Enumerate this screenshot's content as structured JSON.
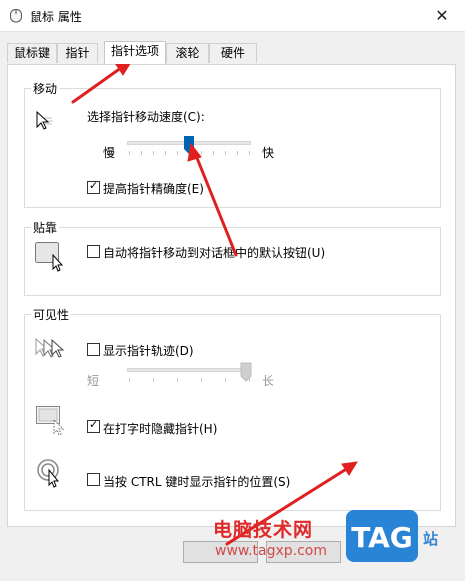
{
  "window": {
    "title": "鼠标 属性",
    "close_symbol": "✕"
  },
  "tabs": [
    {
      "label": "鼠标键",
      "selected": false
    },
    {
      "label": "指针",
      "selected": false
    },
    {
      "label": "指针选项",
      "selected": true
    },
    {
      "label": "滚轮",
      "selected": false
    },
    {
      "label": "硬件",
      "selected": false
    }
  ],
  "motion": {
    "title": "移动",
    "speed_label": "选择指针移动速度(C):",
    "slow_label": "慢",
    "fast_label": "快",
    "speed_value_fraction": 0.5,
    "precision_label": "提高指针精确度(E)",
    "precision_checked": true,
    "icon": "pointer-speed-icon"
  },
  "snap": {
    "title": "贴靠",
    "snap_label": "自动将指针移动到对话框中的默认按钮(U)",
    "snap_checked": false,
    "icon": "snap-to-button-icon"
  },
  "visibility": {
    "title": "可见性",
    "trails_label": "显示指针轨迹(D)",
    "trails_checked": false,
    "short_label": "短",
    "long_label": "长",
    "trail_length_fraction": 1.0,
    "hide_label": "在打字时隐藏指针(H)",
    "hide_checked": true,
    "ctrl_label": "当按 CTRL 键时显示指针的位置(S)",
    "ctrl_checked": false,
    "icons": [
      "pointer-trails-icon",
      "hide-while-typing-icon",
      "ctrl-locate-icon"
    ]
  },
  "watermark": {
    "brand": "电脑技术网",
    "url": "www.tagxp.com",
    "badge": "TAG",
    "tail": "站"
  },
  "check_glyph": "✓",
  "colors": {
    "slider_thumb": "#0063b1",
    "annotation_arrow": "#e02020",
    "tag_badge": "#2a84d6"
  }
}
